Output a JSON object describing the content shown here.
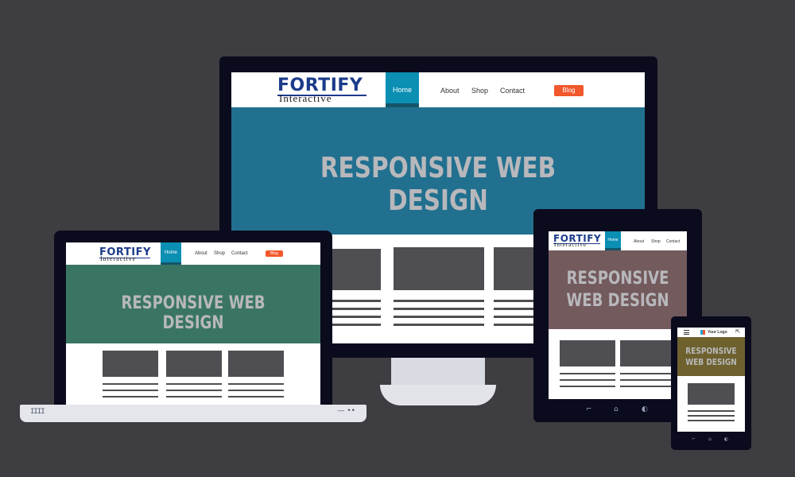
{
  "site": {
    "logo_top": "FORTIFY",
    "logo_bottom": "Interactive",
    "nav": {
      "home": "Home",
      "about": "About",
      "shop": "Shop",
      "contact": "Contact",
      "blog": "Blog"
    },
    "hero_title": "RESPONSIVE WEB DESIGN",
    "hero_title_line1": "RESPONSIVE",
    "hero_title_line2": "WEB DESIGN"
  },
  "phone": {
    "logo_text": "Your Logo"
  },
  "laptop": {
    "keyboard_left": "IIII",
    "keyboard_right": "— ••"
  },
  "tablet": {
    "nav_buttons": [
      "⌐",
      "⌂",
      "◐"
    ]
  },
  "phone_buttons": [
    "⌐",
    "⌂",
    "◐"
  ],
  "colors": {
    "background": "#3e3d42",
    "desktop_hero": "#22708f",
    "laptop_hero": "#3a7563",
    "tablet_hero": "#735a5c",
    "phone_hero": "#6e612e",
    "home_tab": "#0b8fb3",
    "blog_button": "#f1582b",
    "logo": "#1c3b8a"
  }
}
